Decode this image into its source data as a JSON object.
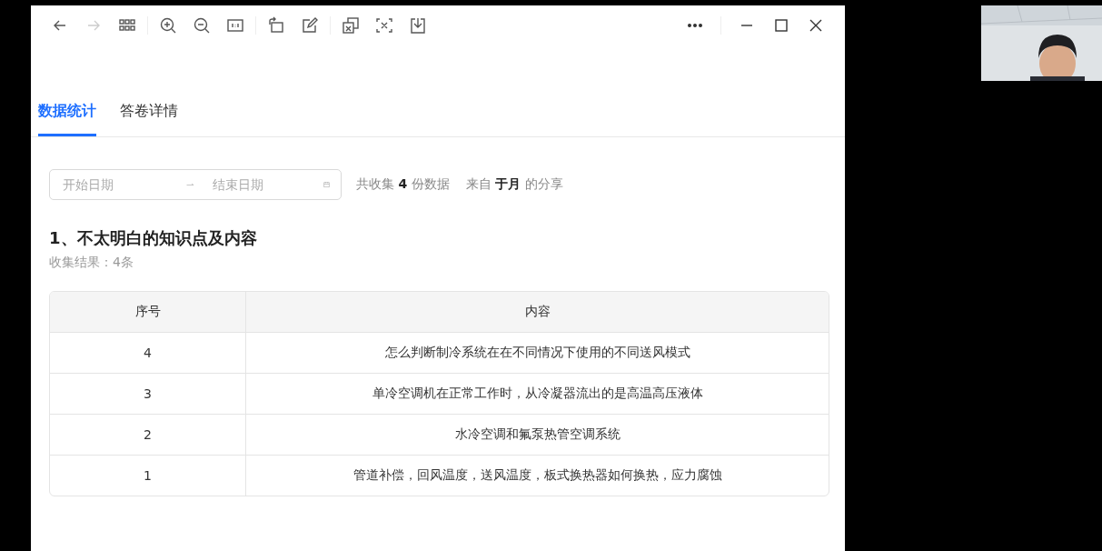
{
  "toolbar": {
    "buttons": [
      {
        "kind": "back",
        "disabled": false
      },
      {
        "kind": "forward",
        "disabled": true
      },
      {
        "kind": "grid",
        "disabled": false
      },
      {
        "kind": "zoom-in",
        "disabled": false
      },
      {
        "kind": "zoom-out",
        "disabled": false
      },
      {
        "kind": "actual-size",
        "disabled": false
      },
      {
        "kind": "rotate",
        "disabled": false
      },
      {
        "kind": "edit",
        "disabled": false
      },
      {
        "kind": "copy",
        "disabled": false
      },
      {
        "kind": "formula",
        "disabled": false
      },
      {
        "kind": "download",
        "disabled": false
      }
    ],
    "window_controls": [
      {
        "kind": "more"
      },
      {
        "kind": "minimize"
      },
      {
        "kind": "maximize"
      },
      {
        "kind": "close"
      }
    ]
  },
  "tabs": [
    {
      "label": "数据统计",
      "selected": true
    },
    {
      "label": "答卷详情",
      "selected": false
    }
  ],
  "filter": {
    "start": {
      "placeholder": "开始日期"
    },
    "end": {
      "placeholder": "结束日期"
    },
    "summary": [
      "共收集 **4** 份数据",
      "来自 **于月** 的分享"
    ]
  },
  "question": {
    "title": "1、不太明白的知识点及内容",
    "result": "收集结果：4条"
  },
  "table": {
    "columns": [
      "序号",
      "内容"
    ],
    "rows": [
      [
        "4",
        "怎么判断制冷系统在在不同情况下使用的不同送风模式"
      ],
      [
        "3",
        "单冷空调机在正常工作时，从冷凝器流出的是高温高压液体"
      ],
      [
        "2",
        "水冷空调和氟泵热管空调系统"
      ],
      [
        "1",
        "管道补偿，回风温度，送风温度，板式换热器如何换热，应力腐蚀"
      ]
    ]
  }
}
